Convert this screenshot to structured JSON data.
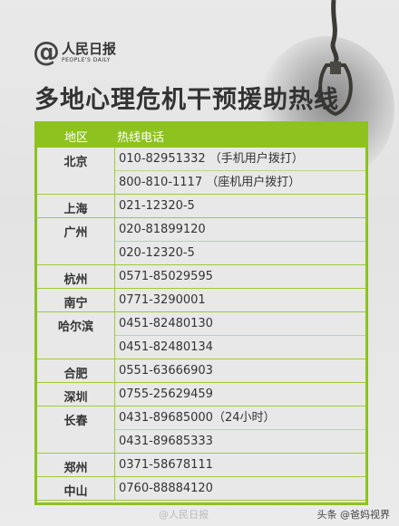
{
  "logo": {
    "symbol": "@",
    "name_cn": "人民日报",
    "name_en": "PEOPLE'S DAILY"
  },
  "title": "多地心理危机干预援助热线",
  "table": {
    "header": {
      "city": "地区",
      "phone": "热线电话"
    },
    "accent_color": "#8dc21f",
    "groups": [
      {
        "city": "北京",
        "phones": [
          "010-82951332 （手机用户拨打）",
          "800-810-1117 （座机用户拨打）"
        ]
      },
      {
        "city": "上海",
        "phones": [
          "021-12320-5"
        ]
      },
      {
        "city": "广州",
        "phones": [
          "020-81899120",
          "020-12320-5"
        ]
      },
      {
        "city": "杭州",
        "phones": [
          "0571-85029595"
        ]
      },
      {
        "city": "南宁",
        "phones": [
          "0771-3290001"
        ]
      },
      {
        "city": "哈尔滨",
        "phones": [
          "0451-82480130",
          "0451-82480134"
        ]
      },
      {
        "city": "合肥",
        "phones": [
          "0551-63666903"
        ]
      },
      {
        "city": "深圳",
        "phones": [
          "0755-25629459"
        ]
      },
      {
        "city": "长春",
        "phones": [
          "0431-89685000（24小时）",
          "0431-89685333"
        ]
      },
      {
        "city": "郑州",
        "phones": [
          "0371-58678111"
        ]
      },
      {
        "city": "中山",
        "phones": [
          "0760-88884120"
        ]
      }
    ]
  },
  "watermark": "@人民日报",
  "corner_credit": "头条 @爸妈视界"
}
